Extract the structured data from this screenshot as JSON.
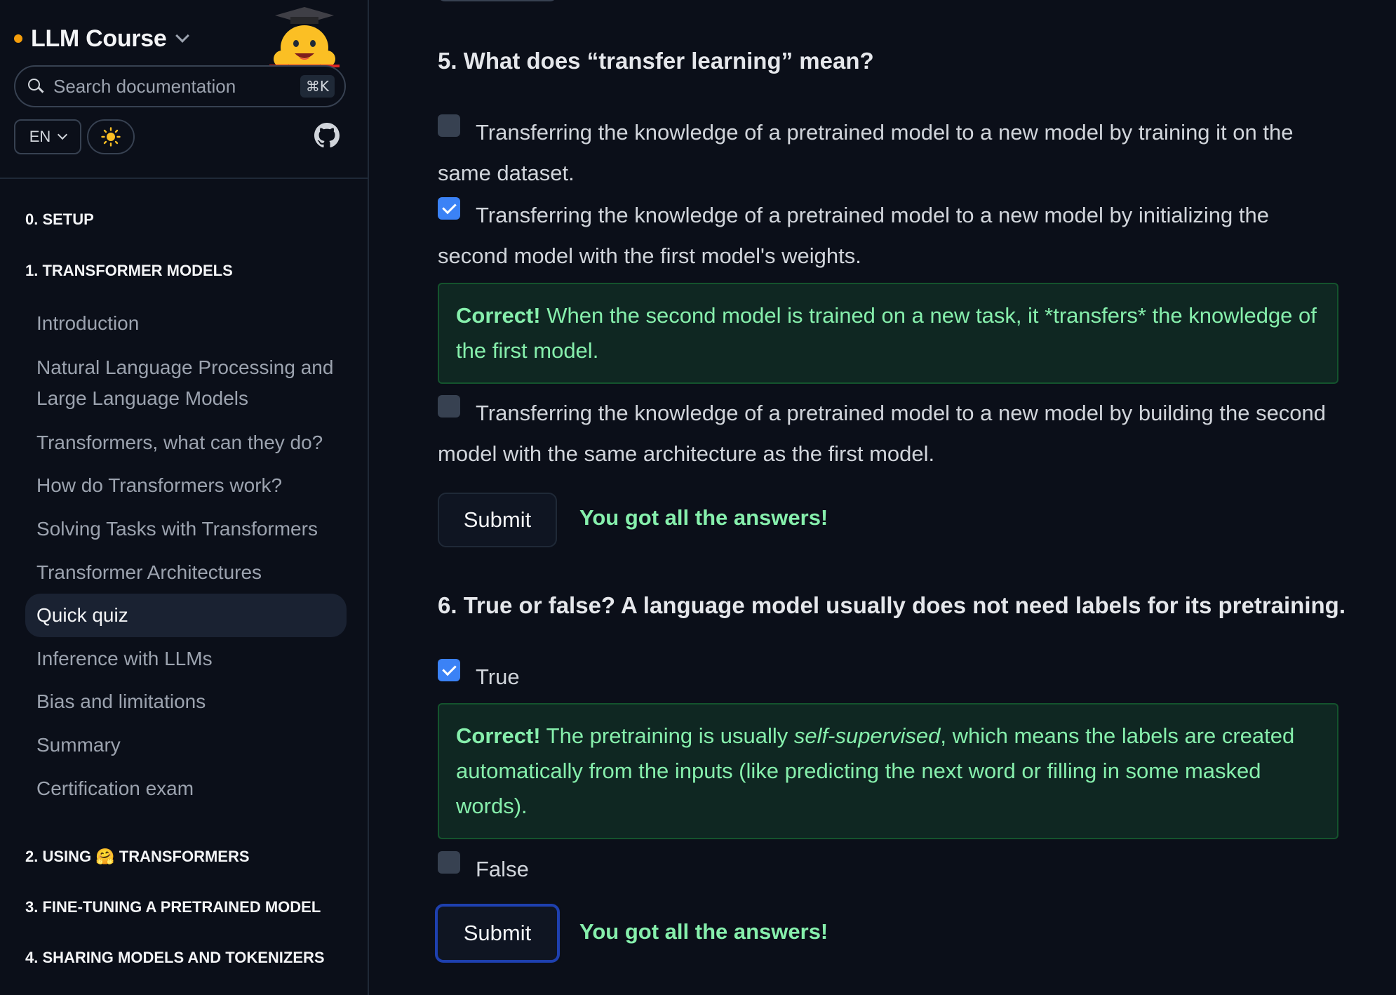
{
  "sidebar": {
    "brand_title": "LLM Course",
    "search_placeholder": "Search documentation",
    "search_shortcut": "⌘K",
    "language": "EN",
    "sections": [
      "0. SETUP",
      "1. TRANSFORMER MODELS",
      "2. USING 🤗 TRANSFORMERS",
      "3. FINE-TUNING A PRETRAINED MODEL",
      "4. SHARING MODELS AND TOKENIZERS"
    ],
    "chapter1_items": [
      "Introduction",
      "Natural Language Processing and Large Language Models",
      "Transformers, what can they do?",
      "How do Transformers work?",
      "Solving Tasks with Transformers",
      "Transformer Architectures",
      "Quick quiz",
      "Inference with LLMs",
      "Bias and limitations",
      "Summary",
      "Certification exam"
    ],
    "active_item": "Quick quiz"
  },
  "quiz": {
    "q5": {
      "title": "5. What does “transfer learning” mean?",
      "options": [
        {
          "text": "Transferring the knowledge of a pretrained model to a new model by training it on the same dataset.",
          "checked": false
        },
        {
          "text": "Transferring the knowledge of a pretrained model to a new model by initializing the second model with the first model's weights.",
          "checked": true
        },
        {
          "text": "Transferring the knowledge of a pretrained model to a new model by building the second model with the same architecture as the first model.",
          "checked": false
        }
      ],
      "feedback_label": "Correct!",
      "feedback_text": "When the second model is trained on a new task, it *transfers* the knowledge of the first model.",
      "submit_label": "Submit",
      "result": "You got all the answers!"
    },
    "q6": {
      "title": "6. True or false? A language model usually does not need labels for its pretraining.",
      "options": [
        {
          "text": "True",
          "checked": true
        },
        {
          "text": "False",
          "checked": false
        }
      ],
      "feedback_label": "Correct!",
      "feedback_pre": "The pretraining is usually ",
      "feedback_em": "self-supervised",
      "feedback_post": ", which means the labels are created automatically from the inputs (like predicting the next word or filling in some masked words).",
      "submit_label": "Submit",
      "result": "You got all the answers!"
    }
  },
  "colors": {
    "background": "#0b0f19",
    "accent": "#3b82f6",
    "correct": "#86efac",
    "brand_dot": "#f59e0b"
  },
  "icons": [
    "hugging-face-mascot-icon",
    "search-icon",
    "chevron-down-icon",
    "sun-icon",
    "github-icon",
    "checkbox-checked-icon"
  ]
}
